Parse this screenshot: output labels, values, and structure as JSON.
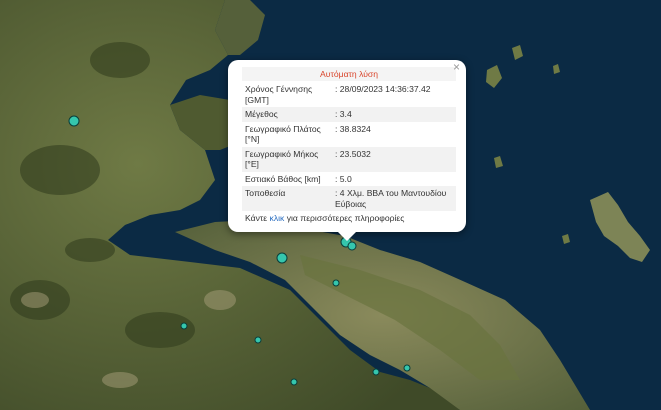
{
  "popup": {
    "title": "Αυτόματη λύση",
    "rows": [
      {
        "label": "Χρόνος Γέννησης [GMT]",
        "value": ": 28/09/2023 14:36:37.42"
      },
      {
        "label": "Μέγεθος",
        "value": ": 3.4"
      },
      {
        "label": "Γεωγραφικό Πλάτος [°N]",
        "value": ": 38.8324"
      },
      {
        "label": "Γεωγραφικό Μήκος [°E]",
        "value": ": 23.5032"
      },
      {
        "label": "Εστιακό Βάθος [km]",
        "value": ": 5.0"
      },
      {
        "label": "Τοποθεσία",
        "value": ": 4 Χλμ. ΒΒΑ του Μαντουδίου Εύβοιας"
      }
    ],
    "more_prefix": "Κάντε ",
    "more_link": "κλικ",
    "more_suffix": " για περισσότερες πληροφορίες",
    "close_icon": "close-icon"
  },
  "colors": {
    "sea": "#0b2a44",
    "land": "#5f6a3a",
    "marker": "#35c6ad",
    "title": "#d9452b",
    "link": "#2a6ec1"
  }
}
